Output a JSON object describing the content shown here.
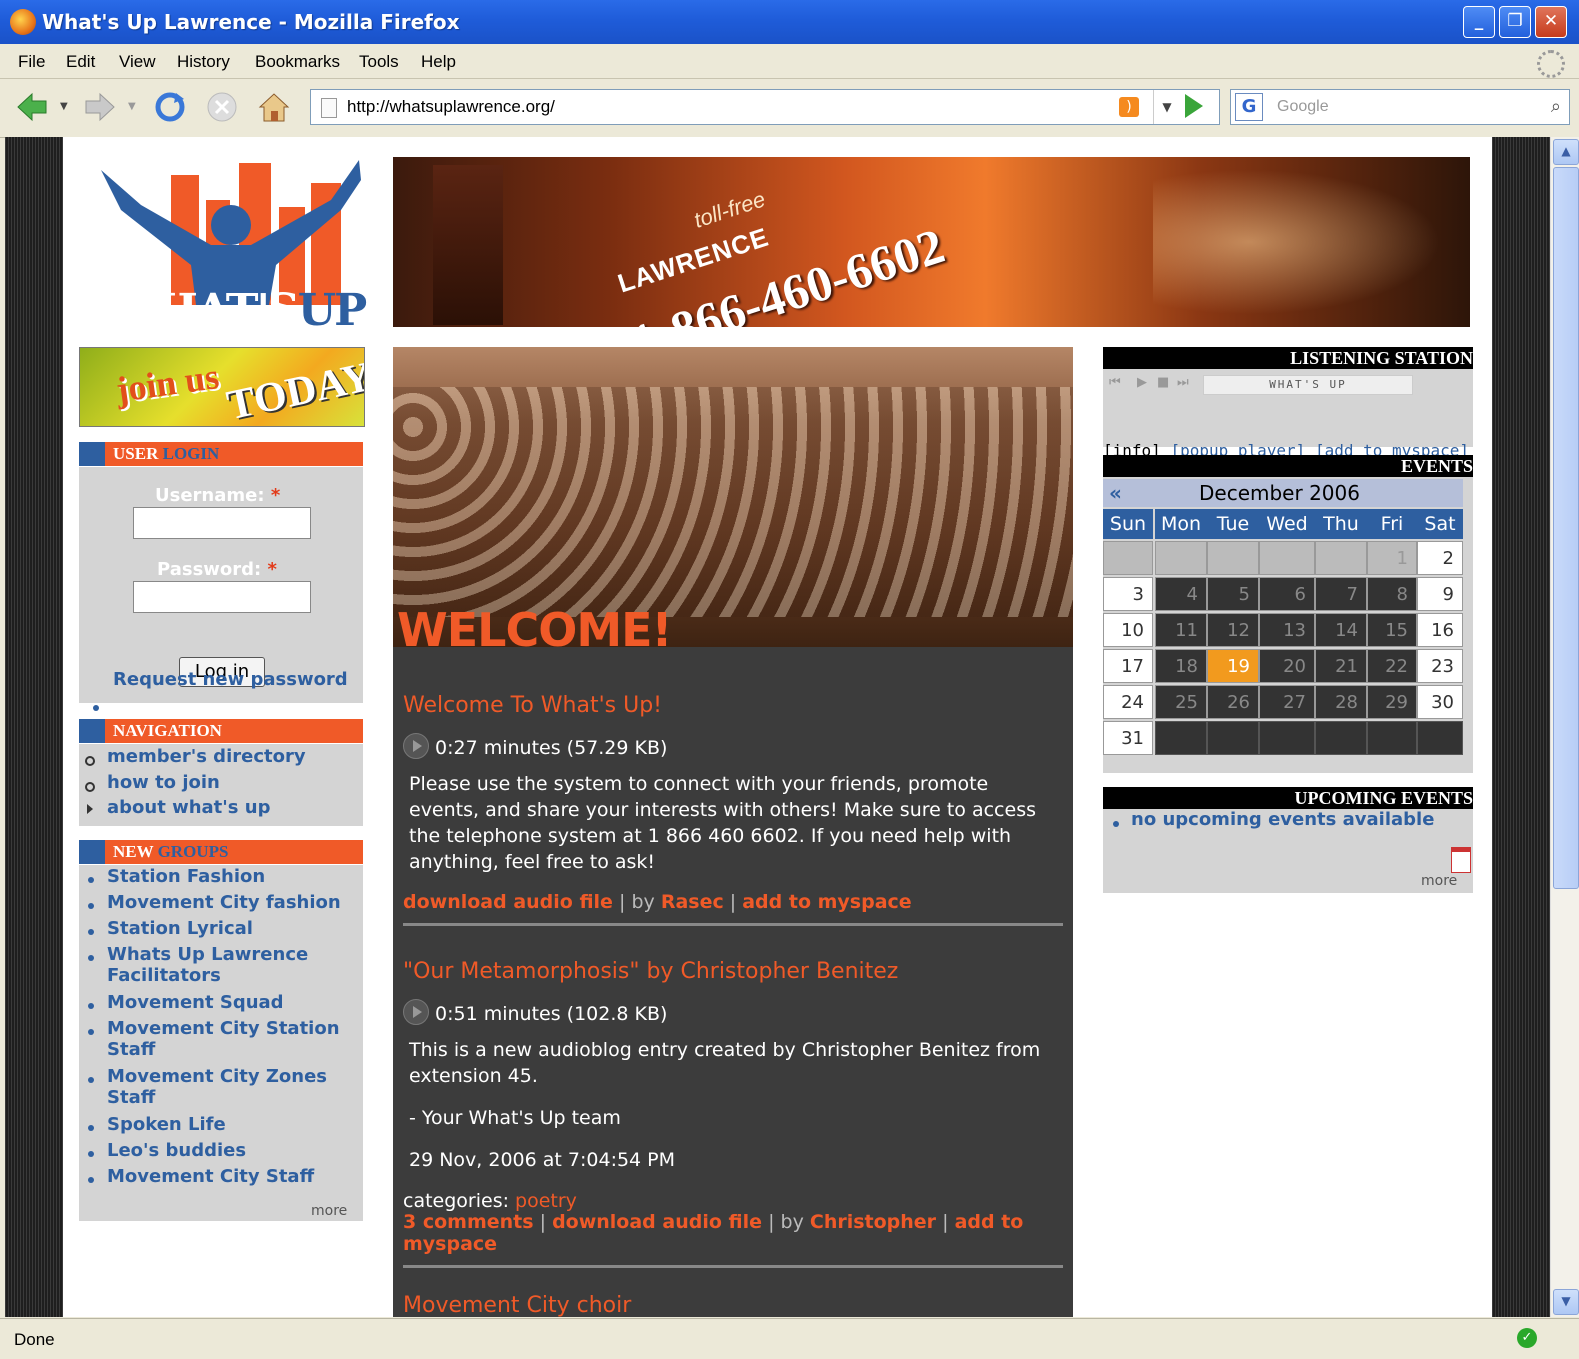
{
  "window": {
    "title": "What's Up Lawrence - Mozilla Firefox",
    "buttons": [
      "_",
      "❐",
      "✕"
    ]
  },
  "menu": [
    "File",
    "Edit",
    "View",
    "History",
    "Bookmarks",
    "Tools",
    "Help"
  ],
  "toolbar": {
    "url": "http://whatsuplawrence.org/",
    "search_placeholder": "Google"
  },
  "status": "Done",
  "site": {
    "logo_text": "WHAT'S",
    "logo_text_b": "UP",
    "banner": {
      "tollfree": "toll-free",
      "lawrence": "LAWRENCE",
      "phone": "1-866-460-6602"
    },
    "joinus": {
      "a": "join us",
      "b": "TODAY!"
    }
  },
  "login": {
    "header_a": "USER",
    "header_b": "LOGIN",
    "username_label": "Username:",
    "password_label": "Password:",
    "required": "*",
    "button": "Log in",
    "request_password": "Request new password"
  },
  "navigation": {
    "header": "NAVIGATION",
    "items": [
      "member's directory",
      "how to join",
      "about what's up"
    ]
  },
  "groups": {
    "header_a": "NEW",
    "header_b": "GROUPS",
    "items": [
      "Station Fashion",
      "Movement City fashion",
      "Station Lyrical",
      "Whats Up Lawrence",
      "Facilitators",
      "Movement Squad",
      "Movement City Station",
      "Staff",
      "Movement City Zones",
      "Staff",
      "Spoken Life",
      "Leo's buddies",
      "Movement City Staff"
    ],
    "more": "more"
  },
  "main": {
    "welcome": "WELCOME!",
    "posts": [
      {
        "title": "Welcome To What's Up!",
        "duration": "0:27 minutes (57.29 KB)",
        "body": "Please use the system to connect with your friends, promote events, and share your interests with others! Make sure to access the telephone system at 1 866 460 6602. If you need help with anything, feel free to ask!",
        "download": "download audio file",
        "by": "by",
        "author": "Rasec",
        "myspace": "add to myspace",
        "sep": "|"
      },
      {
        "title": "\"Our Metamorphosis\" by Christopher Benitez",
        "duration": "0:51 minutes (102.8 KB)",
        "body": "This is a new audioblog entry created by Christopher Benitez from extension 45.",
        "signoff": "- Your What's Up team",
        "date": "29 Nov, 2006 at 7:04:54 PM",
        "categories_label": "categories:",
        "category": "poetry",
        "comments": "3 comments",
        "download": "download audio file",
        "by": "by",
        "author": "Christopher",
        "myspace_a": "add to",
        "myspace_b": "myspace",
        "sep": "|"
      },
      {
        "title": "Movement City choir"
      }
    ]
  },
  "listening": {
    "header": "LISTENING STATION",
    "screen": "WHAT'S UP",
    "links": {
      "info": "[info]",
      "popup": "[popup player]",
      "myspace": "[add to myspace]"
    }
  },
  "events": {
    "header": "EVENTS",
    "prev": "«",
    "month": "December 2006",
    "dows": [
      "Sun",
      "Mon",
      "Tue",
      "Wed",
      "Thu",
      "Fri",
      "Sat"
    ],
    "weeks": [
      [
        "",
        "",
        "",
        "",
        "",
        "1",
        "2"
      ],
      [
        "3",
        "4",
        "5",
        "6",
        "7",
        "8",
        "9"
      ],
      [
        "10",
        "11",
        "12",
        "13",
        "14",
        "15",
        "16"
      ],
      [
        "17",
        "18",
        "19",
        "20",
        "21",
        "22",
        "23"
      ],
      [
        "24",
        "25",
        "26",
        "27",
        "28",
        "29",
        "30"
      ],
      [
        "31",
        "",
        "",
        "",
        "",
        "",
        ""
      ]
    ],
    "today": "19"
  },
  "upcoming": {
    "header": "UPCOMING EVENTS",
    "item": "no upcoming events available",
    "more": "more"
  },
  "colors": {
    "orange": "#f05a28",
    "blue": "#2e5fa0",
    "today": "#f29a1e"
  }
}
